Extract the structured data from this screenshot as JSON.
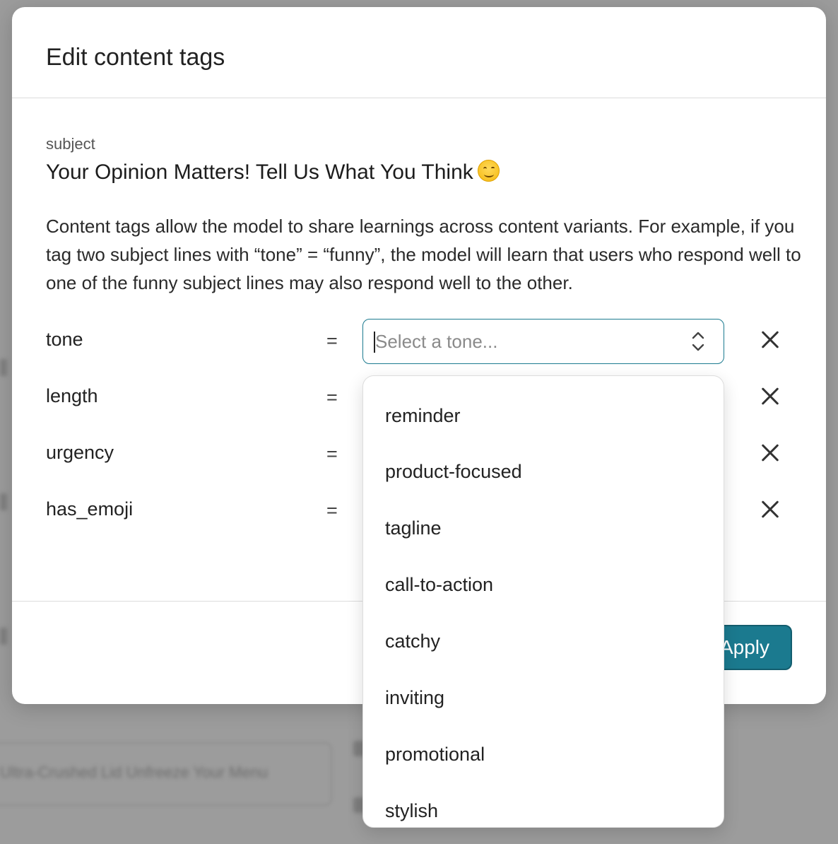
{
  "modal": {
    "title": "Edit content tags",
    "subject_label": "subject",
    "subject_text": "Your Opinion Matters! Tell Us What You Think",
    "description": "Content tags allow the model to share learnings across content variants. For example, if you tag two subject lines with “tone” = “funny”, the model will learn that users who respond well to one of the funny subject lines may also respond well to the other.",
    "tags": [
      {
        "key": "tone",
        "operator": "="
      },
      {
        "key": "length",
        "operator": "="
      },
      {
        "key": "urgency",
        "operator": "="
      },
      {
        "key": "has_emoji",
        "operator": "="
      }
    ],
    "tone_select": {
      "placeholder": "Select a tone..."
    },
    "apply_label": "Apply",
    "accent_color": "#1b7a8f"
  },
  "dropdown": {
    "options": [
      "reminder",
      "product-focused",
      "tagline",
      "call-to-action",
      "catchy",
      "inviting",
      "promotional",
      "stylish"
    ]
  },
  "background": {
    "blurred_text": "Ultra-Crushed Lid Unfreeze Your Menu"
  },
  "icons": {
    "remove": "close-icon",
    "select": "chevron-updown-icon",
    "emoji": "smiling-face-emoji-icon"
  }
}
